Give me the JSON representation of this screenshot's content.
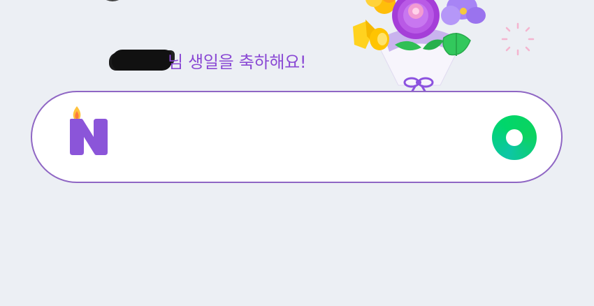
{
  "greeting": {
    "text": "님 생일을 축하해요!"
  },
  "search": {
    "value": "",
    "placeholder": ""
  },
  "icons": {
    "logo": "naver-birthday-n-logo",
    "bouquet": "flower-bouquet-icon",
    "sparkle": "sparkle-decoration-icon",
    "search": "naver-green-search-icon"
  },
  "colors": {
    "background": "#eceff4",
    "accent_purple": "#8a49d4",
    "logo_purple": "#8b55d9",
    "search_green": "#00d66b",
    "search_border": "#8f66c4"
  }
}
